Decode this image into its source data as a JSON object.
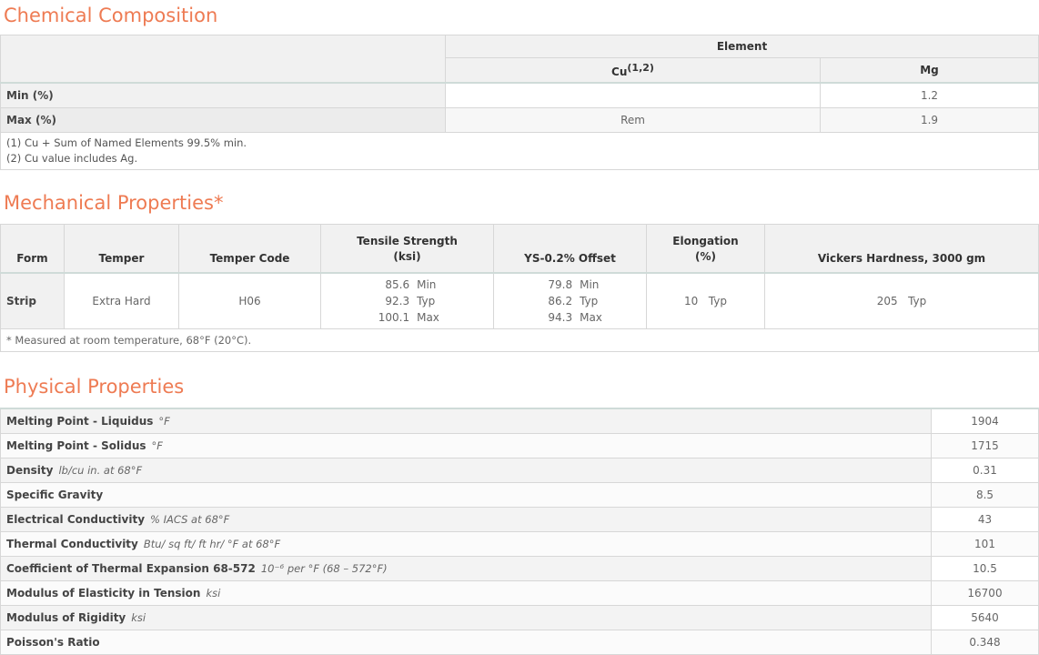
{
  "chemical": {
    "title": "Chemical Composition",
    "group_header": "Element",
    "columns": [
      {
        "name": "Cu",
        "sup": "(1,2)"
      },
      {
        "name": "Mg",
        "sup": ""
      }
    ],
    "rows": [
      {
        "label": "Min (%)",
        "values": [
          "",
          "1.2"
        ]
      },
      {
        "label": "Max (%)",
        "values": [
          "Rem",
          "1.9"
        ]
      }
    ],
    "notes": [
      "(1) Cu + Sum of Named Elements 99.5% min.",
      "(2) Cu value includes Ag."
    ]
  },
  "mechanical": {
    "title": "Mechanical Properties*",
    "headers": [
      "Form",
      "Temper",
      "Temper Code",
      "Tensile Strength",
      "(ksi)",
      "YS-0.2% Offset",
      "Elongation",
      "(%)",
      "Vickers Hardness, 3000 gm"
    ],
    "row": {
      "form": "Strip",
      "temper": "Extra Hard",
      "temper_code": "H06",
      "tensile": [
        {
          "v": "85.6",
          "t": "Min"
        },
        {
          "v": "92.3",
          "t": "Typ"
        },
        {
          "v": "100.1",
          "t": "Max"
        }
      ],
      "ys": [
        {
          "v": "79.8",
          "t": "Min"
        },
        {
          "v": "86.2",
          "t": "Typ"
        },
        {
          "v": "94.3",
          "t": "Max"
        }
      ],
      "elongation": {
        "v": "10",
        "t": "Typ"
      },
      "hardness": {
        "v": "205",
        "t": "Typ"
      }
    },
    "note": "* Measured at room temperature, 68°F (20°C)."
  },
  "physical": {
    "title": "Physical Properties",
    "rows": [
      {
        "label": "Melting Point - Liquidus",
        "unit": "°F",
        "value": "1904"
      },
      {
        "label": "Melting Point - Solidus",
        "unit": "°F",
        "value": "1715"
      },
      {
        "label": "Density",
        "unit": "lb/cu in. at 68°F",
        "value": "0.31"
      },
      {
        "label": "Specific Gravity",
        "unit": "",
        "value": "8.5"
      },
      {
        "label": "Electrical Conductivity",
        "unit": "% IACS at 68°F",
        "value": "43"
      },
      {
        "label": "Thermal Conductivity",
        "unit": "Btu/ sq ft/ ft hr/ °F at 68°F",
        "value": "101"
      },
      {
        "label": "Coefficient of Thermal Expansion 68-572",
        "unit": "10⁻⁶ per °F (68 – 572°F)",
        "value": "10.5"
      },
      {
        "label": "Modulus of Elasticity in Tension",
        "unit": "ksi",
        "value": "16700"
      },
      {
        "label": "Modulus of Rigidity",
        "unit": "ksi",
        "value": "5640"
      },
      {
        "label": "Poisson's Ratio",
        "unit": "",
        "value": "0.348"
      }
    ]
  },
  "colors": {
    "accent": "#ee7b53",
    "header_bg": "#f1f1f1",
    "border": "#d7d7d7"
  }
}
